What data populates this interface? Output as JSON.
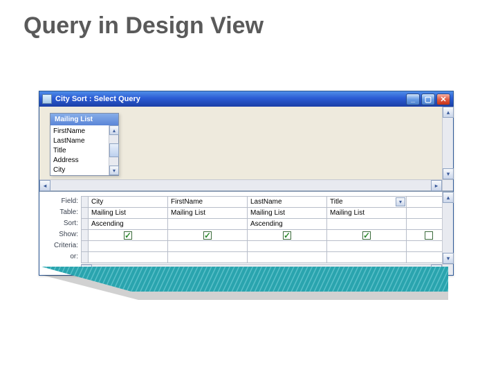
{
  "slide": {
    "title": "Query in Design View"
  },
  "window": {
    "title": "City Sort : Select Query",
    "table_box": {
      "header": "Mailing List",
      "fields": [
        "FirstName",
        "LastName",
        "Title",
        "Address",
        "City"
      ]
    }
  },
  "grid": {
    "row_labels": [
      "Field:",
      "Table:",
      "Sort:",
      "Show:",
      "Criteria:",
      "or:"
    ],
    "columns": [
      {
        "field": "City",
        "table": "Mailing List",
        "sort": "Ascending",
        "show": true,
        "dropdown": false
      },
      {
        "field": "FirstName",
        "table": "Mailing List",
        "sort": "",
        "show": true,
        "dropdown": false
      },
      {
        "field": "LastName",
        "table": "Mailing List",
        "sort": "Ascending",
        "show": true,
        "dropdown": false
      },
      {
        "field": "Title",
        "table": "Mailing List",
        "sort": "",
        "show": true,
        "dropdown": true
      }
    ]
  }
}
